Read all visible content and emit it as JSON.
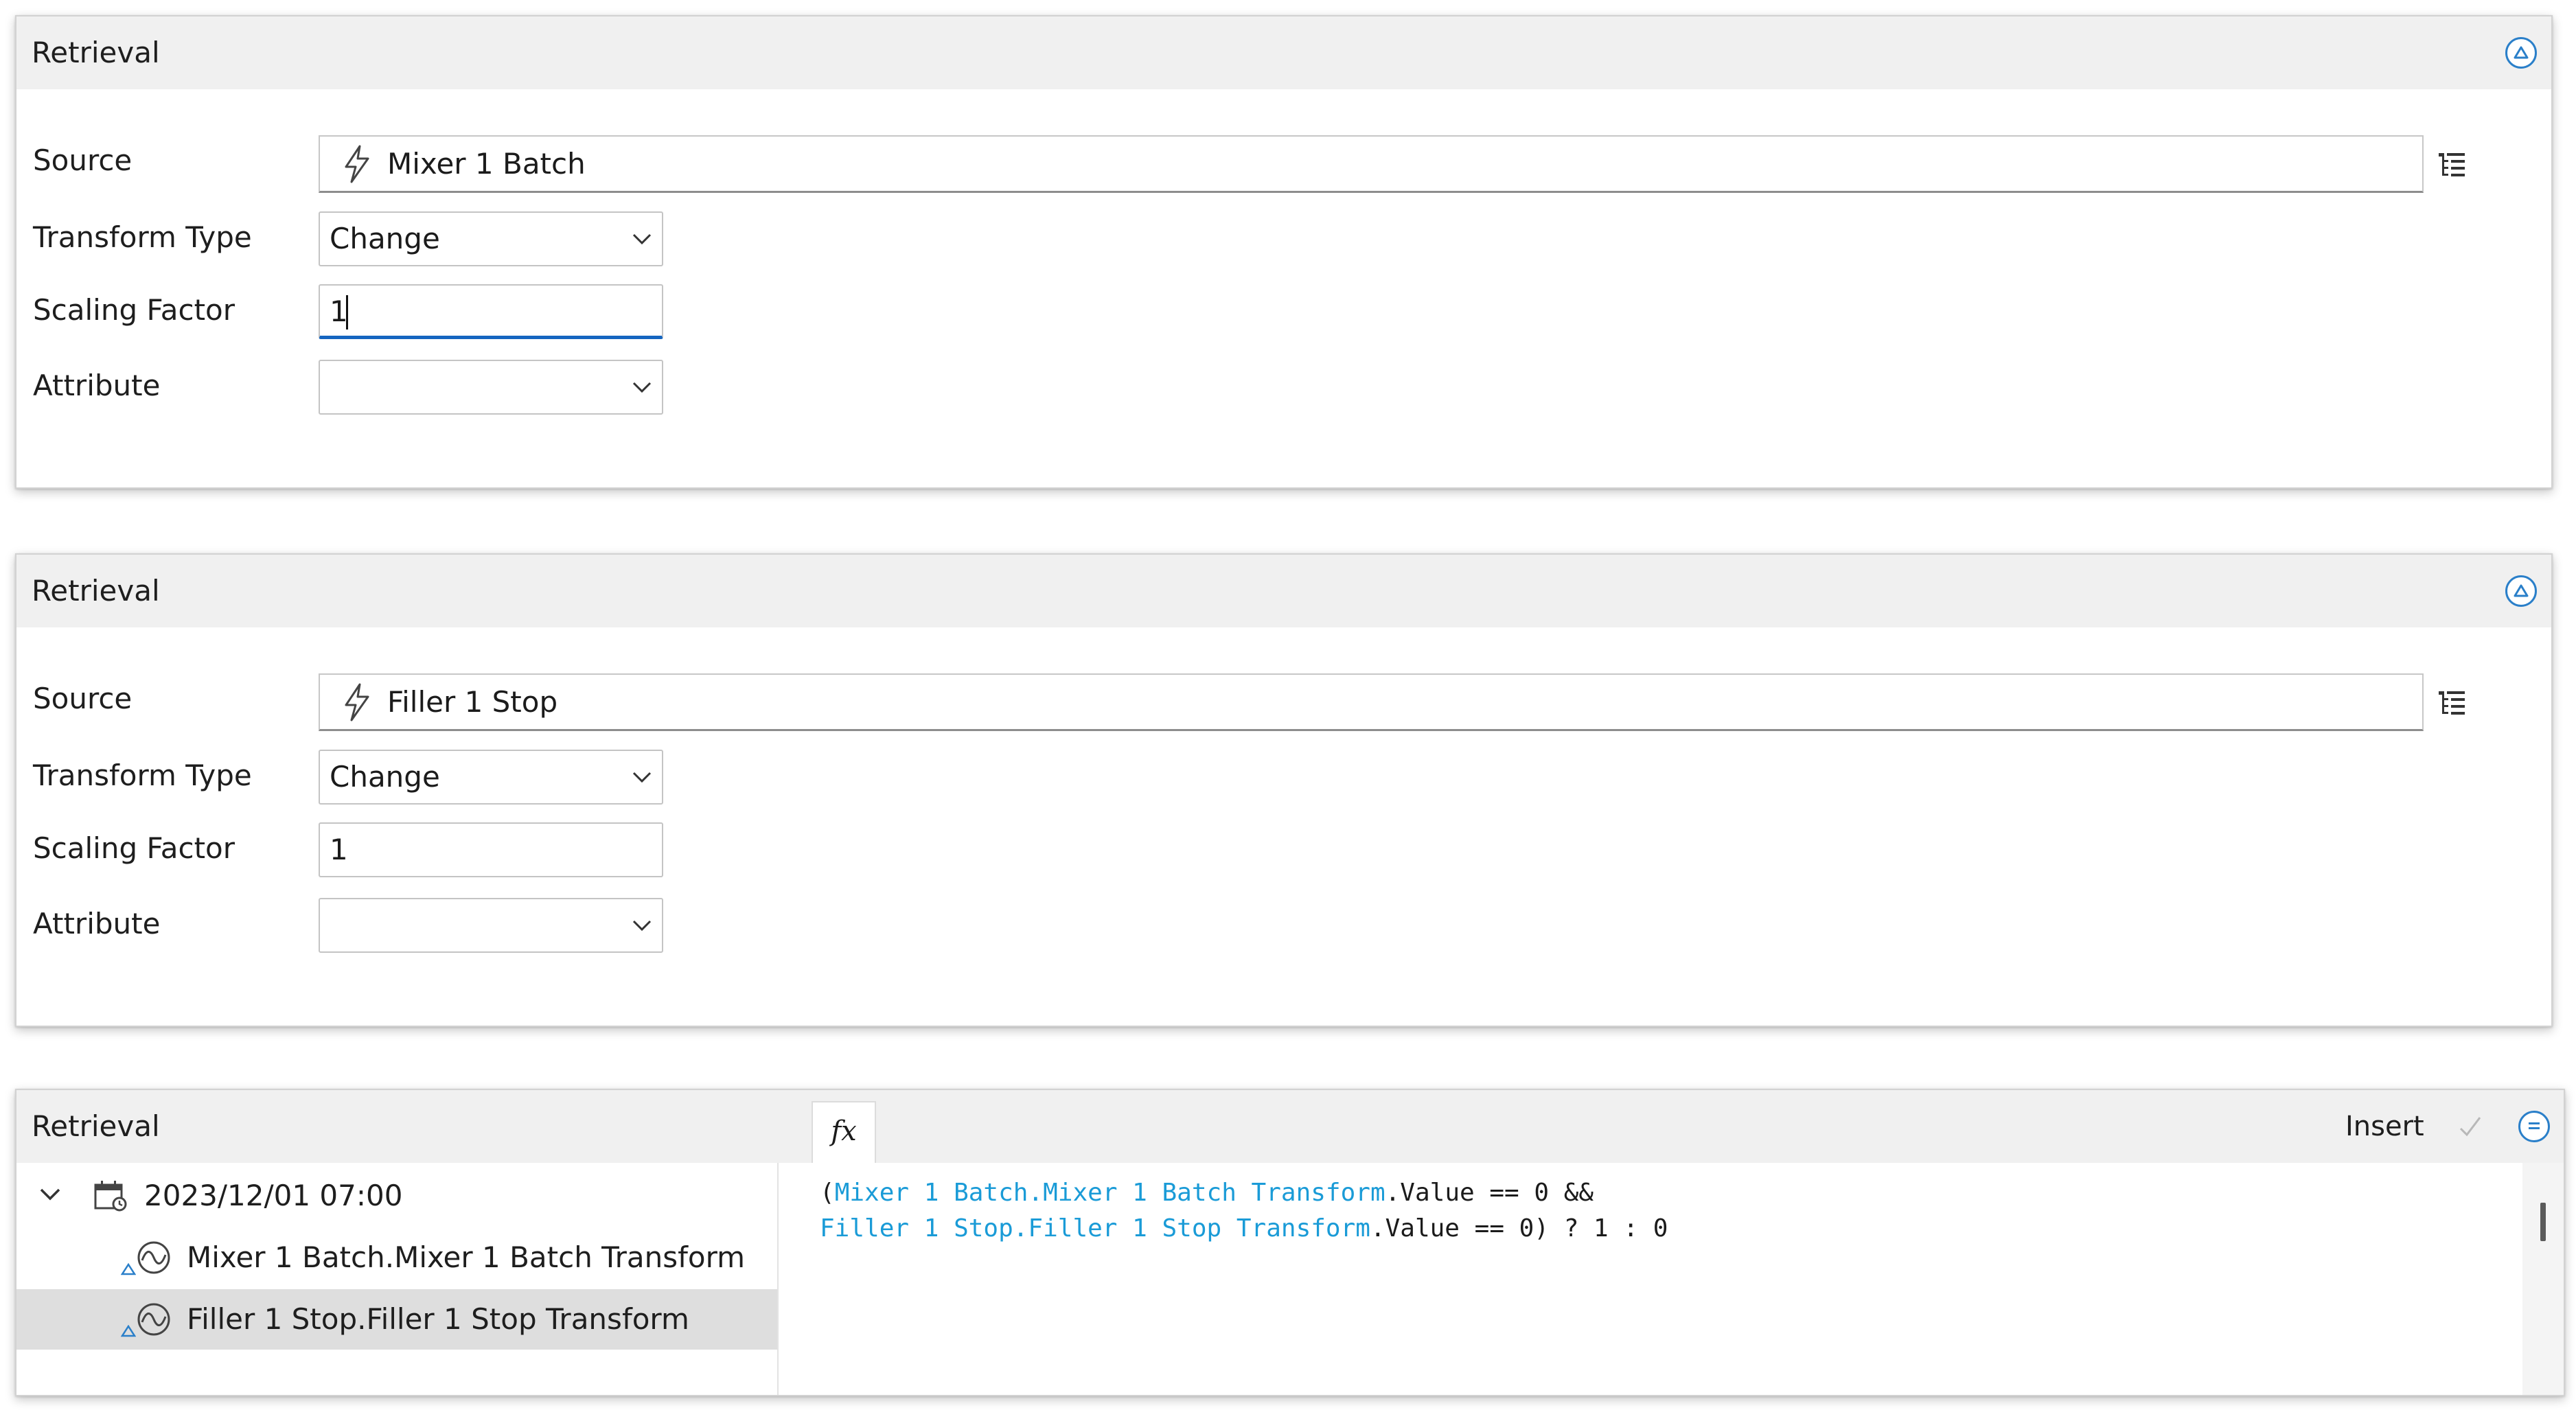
{
  "panel1": {
    "title": "Retrieval",
    "source_label": "Source",
    "source_value": "Mixer 1 Batch",
    "transform_label": "Transform Type",
    "transform_value": "Change",
    "scaling_label": "Scaling Factor",
    "scaling_value": "1",
    "attribute_label": "Attribute",
    "attribute_value": ""
  },
  "panel2": {
    "title": "Retrieval",
    "source_label": "Source",
    "source_value": "Filler 1 Stop",
    "transform_label": "Transform Type",
    "transform_value": "Change",
    "scaling_label": "Scaling Factor",
    "scaling_value": "1",
    "attribute_label": "Attribute",
    "attribute_value": ""
  },
  "panel3": {
    "title": "Retrieval",
    "fx_label": "fx",
    "insert_label": "Insert",
    "tree": {
      "date": "2023/12/01 07:00",
      "items": [
        {
          "label": "Mixer 1 Batch.Mixer 1 Batch Transform"
        },
        {
          "label": "Filler 1 Stop.Filler 1 Stop Transform"
        }
      ]
    },
    "code": {
      "l1_open": "(",
      "l1_ref": "Mixer 1 Batch.Mixer 1 Batch Transform",
      "l1_rest": ".Value == 0 &&",
      "l2_ref": "Filler 1 Stop.Filler 1 Stop Transform",
      "l2_rest": ".Value == 0) ? 1 : 0"
    }
  },
  "colors": {
    "accent": "#2a7fc9",
    "focus_underline": "#1565c0",
    "code_reference": "#1a9bd7",
    "header_bg": "#f0f0f0",
    "selected_row": "#dedede"
  },
  "icons": {
    "collapse": "collapse-up-circle-icon",
    "expand_less": "collapse-lines-circle-icon",
    "source_type": "lightning-bolt-icon",
    "tree_picker": "tree-list-icon",
    "dropdown": "chevron-down-icon",
    "date": "calendar-icon",
    "transform": "wave-circle-icon",
    "apply": "check-icon"
  }
}
